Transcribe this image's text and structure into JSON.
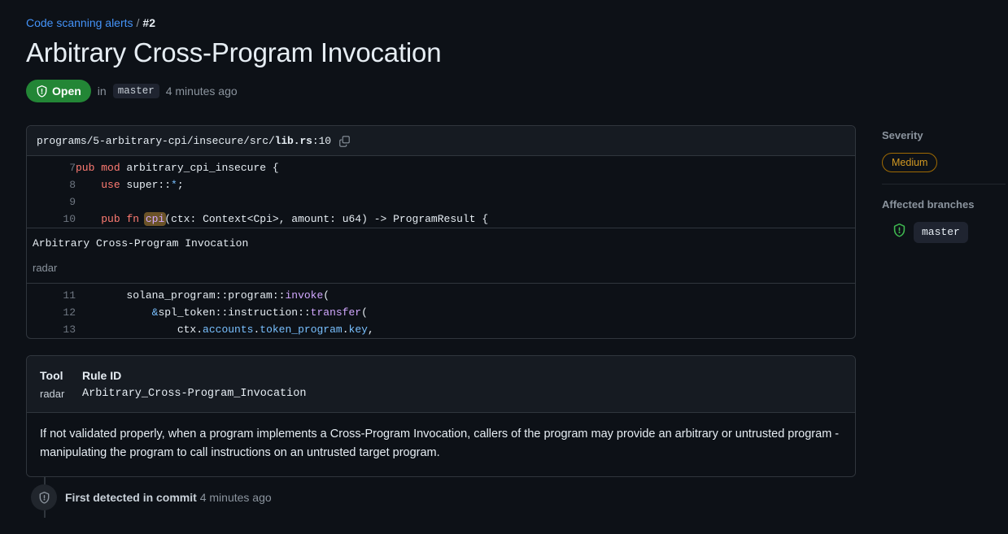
{
  "breadcrumb": {
    "parent": "Code scanning alerts",
    "separator": "/",
    "number": "#2"
  },
  "alert": {
    "title": "Arbitrary Cross-Program Invocation",
    "state_label": "Open",
    "state_color": "#238636",
    "in_label": "in",
    "branch": "master",
    "time_ago": "4 minutes ago"
  },
  "code": {
    "path_prefix": "programs/5-arbitrary-cpi/insecure/src/",
    "path_file": "lib.rs",
    "path_suffix": ":10",
    "copy_icon": "copy-icon",
    "lines": [
      {
        "num": "7",
        "indent": "",
        "tokens": [
          {
            "t": "pub",
            "c": "k"
          },
          {
            "t": " ",
            "c": ""
          },
          {
            "t": "mod",
            "c": "k"
          },
          {
            "t": " arbitrary_cpi_insecure {",
            "c": ""
          }
        ]
      },
      {
        "num": "8",
        "indent": "    ",
        "tokens": [
          {
            "t": "use",
            "c": "k"
          },
          {
            "t": " super::",
            "c": ""
          },
          {
            "t": "*",
            "c": "op"
          },
          {
            "t": ";",
            "c": ""
          }
        ]
      },
      {
        "num": "9",
        "indent": "",
        "tokens": []
      },
      {
        "num": "10",
        "indent": "    ",
        "tokens": [
          {
            "t": "pub",
            "c": "k"
          },
          {
            "t": " ",
            "c": ""
          },
          {
            "t": "fn",
            "c": "k"
          },
          {
            "t": " ",
            "c": ""
          },
          {
            "t": "cpi",
            "c": "fn hl"
          },
          {
            "t": "(ctx: Context<Cpi>, amount: u64) -> ProgramResult {",
            "c": ""
          }
        ]
      }
    ],
    "lines_after": [
      {
        "num": "11",
        "indent": "        ",
        "tokens": [
          {
            "t": "solana_program::program::",
            "c": ""
          },
          {
            "t": "invoke",
            "c": "fn"
          },
          {
            "t": "(",
            "c": ""
          }
        ]
      },
      {
        "num": "12",
        "indent": "            ",
        "tokens": [
          {
            "t": "&",
            "c": "op"
          },
          {
            "t": "spl_token::instruction::",
            "c": ""
          },
          {
            "t": "transfer",
            "c": "fn"
          },
          {
            "t": "(",
            "c": ""
          }
        ]
      },
      {
        "num": "13",
        "indent": "                ",
        "tokens": [
          {
            "t": "ctx.",
            "c": ""
          },
          {
            "t": "accounts",
            "c": "pr"
          },
          {
            "t": ".",
            "c": ""
          },
          {
            "t": "token_program",
            "c": "pr"
          },
          {
            "t": ".",
            "c": ""
          },
          {
            "t": "key",
            "c": "pr"
          },
          {
            "t": ",",
            "c": ""
          }
        ]
      }
    ],
    "annotation": {
      "title": "Arbitrary Cross-Program Invocation",
      "tool": "radar",
      "accent_color": "#d29922"
    }
  },
  "details": {
    "tool_label": "Tool",
    "tool_value": "radar",
    "rule_label": "Rule ID",
    "rule_value": "Arbitrary_Cross-Program_Invocation",
    "description": "If not validated properly, when a program implements a Cross-Program Invocation, callers of the program may provide an arbitrary or untrusted program - manipulating the program to call instructions on an untrusted target program."
  },
  "timeline": {
    "icon": "shield-alert-icon",
    "event_label": "First detected in commit",
    "event_time": "4 minutes ago"
  },
  "sidebar": {
    "severity": {
      "title": "Severity",
      "value": "Medium",
      "color": "#d29922"
    },
    "branches": {
      "title": "Affected branches",
      "icon": "shield-alert-icon",
      "icon_color": "#3fb950",
      "items": [
        "master"
      ]
    }
  }
}
